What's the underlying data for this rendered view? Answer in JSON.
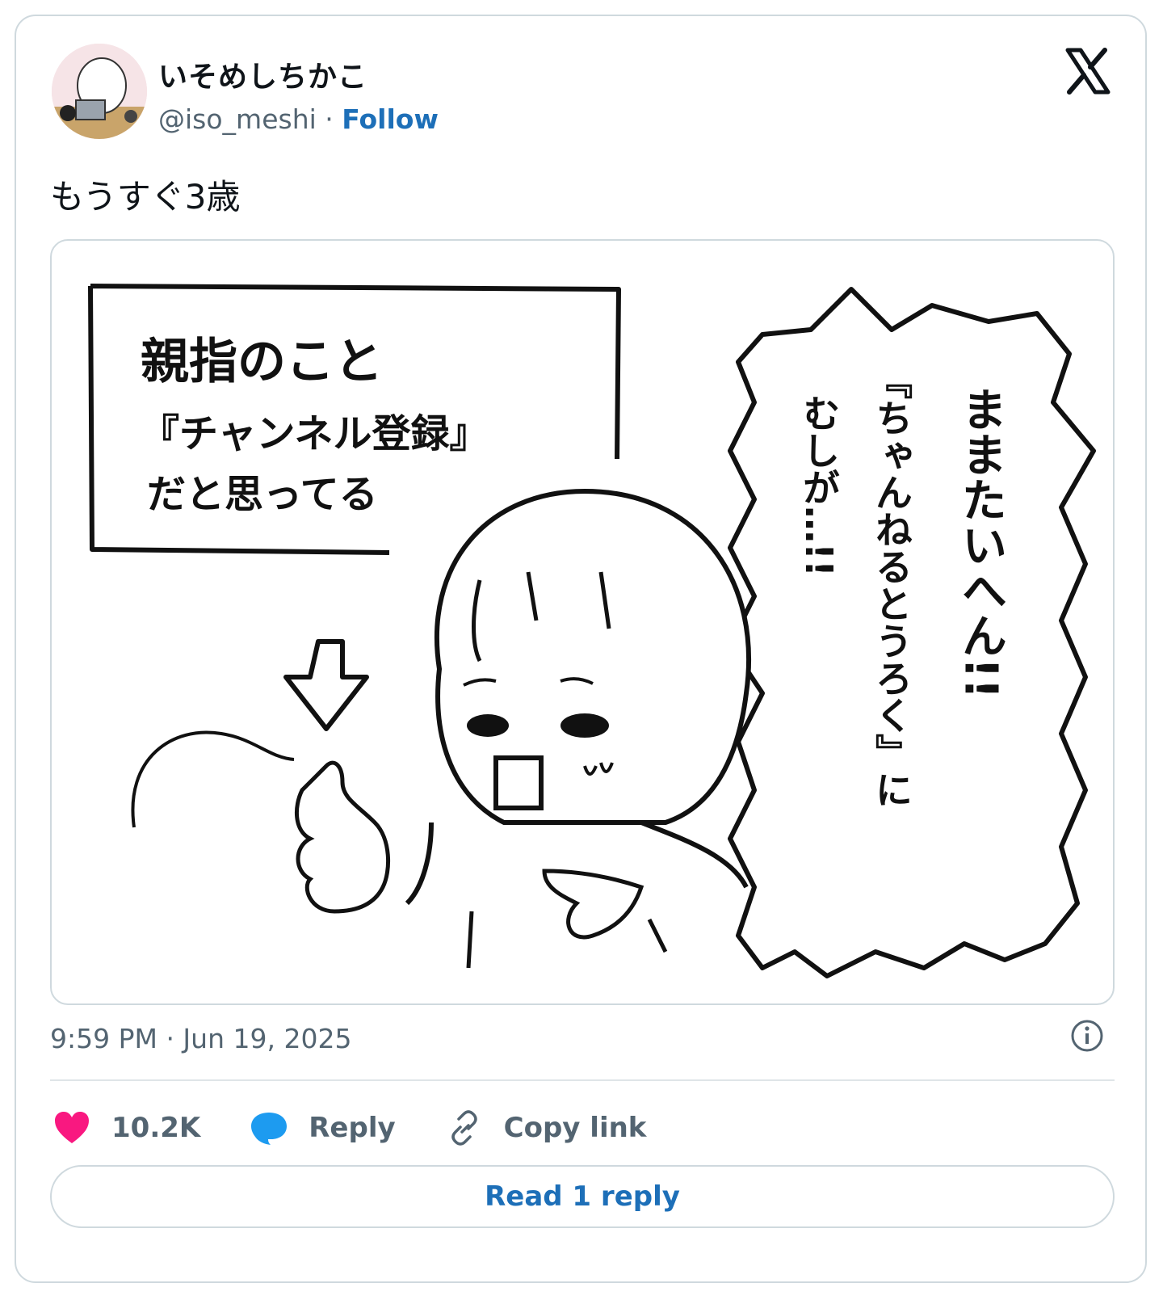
{
  "author": {
    "display_name": "いそめしちかこ",
    "handle": "@iso_meshi",
    "separator": "·",
    "follow_label": "Follow"
  },
  "tweet": {
    "text": "もうすぐ3歳",
    "timestamp": "9:59 PM · Jun 19, 2025"
  },
  "comic": {
    "caption_line1": "親指のこと",
    "caption_line2": "『チャンネル登録』",
    "caption_line3": "だと思ってる",
    "bubble_col1": "ままたいへん!!",
    "bubble_col2": "『ちゃんねるとうろく』に",
    "bubble_col3": "むしが…!!"
  },
  "actions": {
    "like_count": "10.2K",
    "reply_label": "Reply",
    "copy_link_label": "Copy link"
  },
  "read_replies_label": "Read 1 reply",
  "colors": {
    "like": "#f91880",
    "reply": "#1d9bf0",
    "link": "#1d6fb8",
    "secondary_text": "#536471",
    "border": "#cfd9de"
  },
  "icons": [
    "x-logo-icon",
    "heart-icon",
    "reply-bubble-icon",
    "link-icon",
    "info-icon"
  ]
}
